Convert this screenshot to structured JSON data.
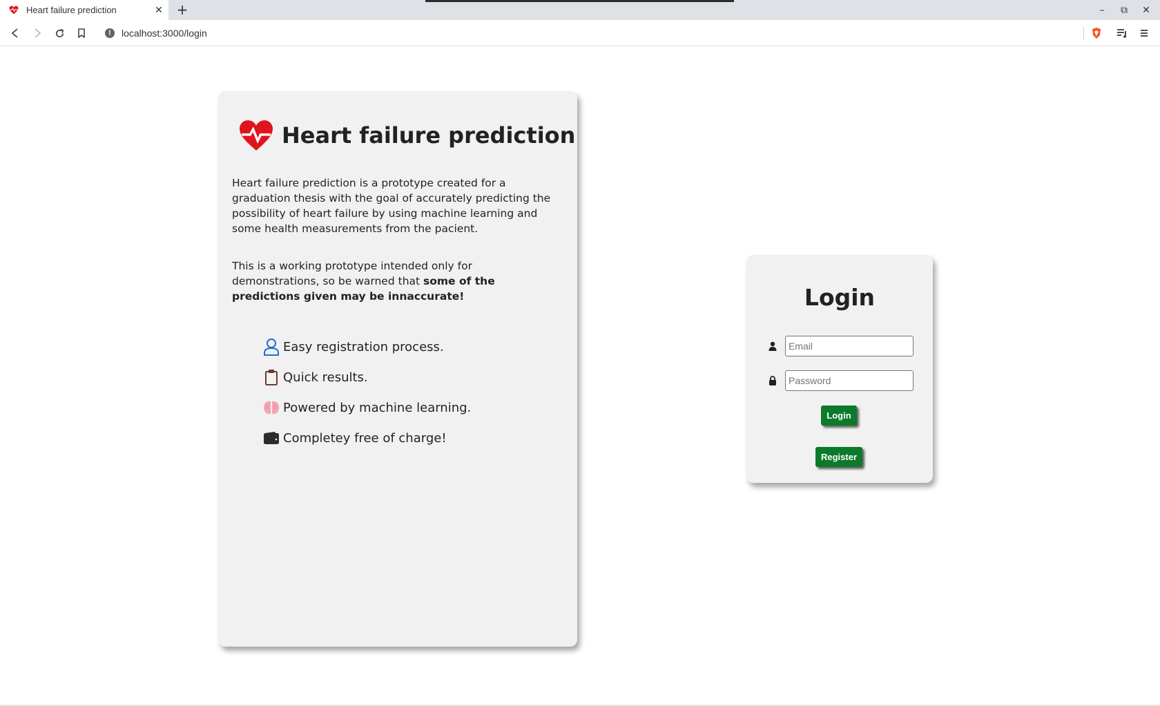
{
  "browser": {
    "tab_title": "Heart failure prediction",
    "tab_close": "✕",
    "new_tab": "+",
    "url": "localhost:3000/login",
    "window_controls": {
      "minimize": "–",
      "restore": "⧉",
      "close": "✕"
    }
  },
  "info_card": {
    "title": "Heart failure prediction",
    "title_icon": "heart-pulse-icon",
    "description": "Heart failure prediction is a prototype created for a graduation thesis with the goal of accurately predicting the possibility of heart failure by using machine learning and some health measurements from the pacient.",
    "warning_prefix": "This is a working prototype intended only for demonstrations, so be warned that ",
    "warning_bold": "some of the predictions given may be innaccurate!",
    "features": [
      {
        "icon": "user-icon",
        "color": "#1f6fd6",
        "text": "Easy registration process."
      },
      {
        "icon": "clipboard-icon",
        "color": "#6b3a2a",
        "text": "Quick results."
      },
      {
        "icon": "brain-icon",
        "color": "#f4a3b4",
        "text": "Powered by machine learning."
      },
      {
        "icon": "wallet-icon",
        "color": "#2b2b2b",
        "text": "Completey free of charge!"
      }
    ]
  },
  "login": {
    "title": "Login",
    "email_placeholder": "Email",
    "password_placeholder": "Password",
    "login_label": "Login",
    "register_label": "Register"
  },
  "colors": {
    "accent_heart": "#e0141e",
    "button_green": "#0b7a2b",
    "card_bg": "#f1f1f1"
  }
}
